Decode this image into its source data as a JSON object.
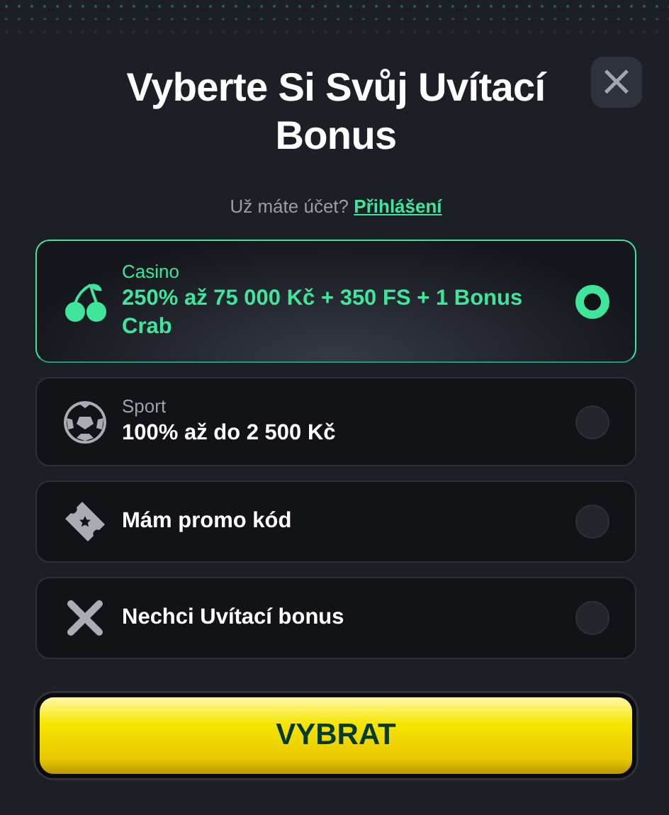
{
  "dialog": {
    "title": "Vyberte Si Svůj Uvítací Bonus",
    "close_label": "×"
  },
  "login_prompt": {
    "text": "Už máte účet?",
    "link": "Přihlášení"
  },
  "options": [
    {
      "kind": "casino",
      "category": "Casino",
      "label": "250% až 75 000 Kč + 350 FS + 1 Bonus Crab",
      "selected": true
    },
    {
      "kind": "sport",
      "category": "Sport",
      "label": "100% až do 2 500 Kč",
      "selected": false
    },
    {
      "kind": "promo",
      "label": "Mám promo kód",
      "selected": false
    },
    {
      "kind": "none",
      "label": "Nechci Uvítací bonus",
      "selected": false
    }
  ],
  "submit": "VYBRAT"
}
